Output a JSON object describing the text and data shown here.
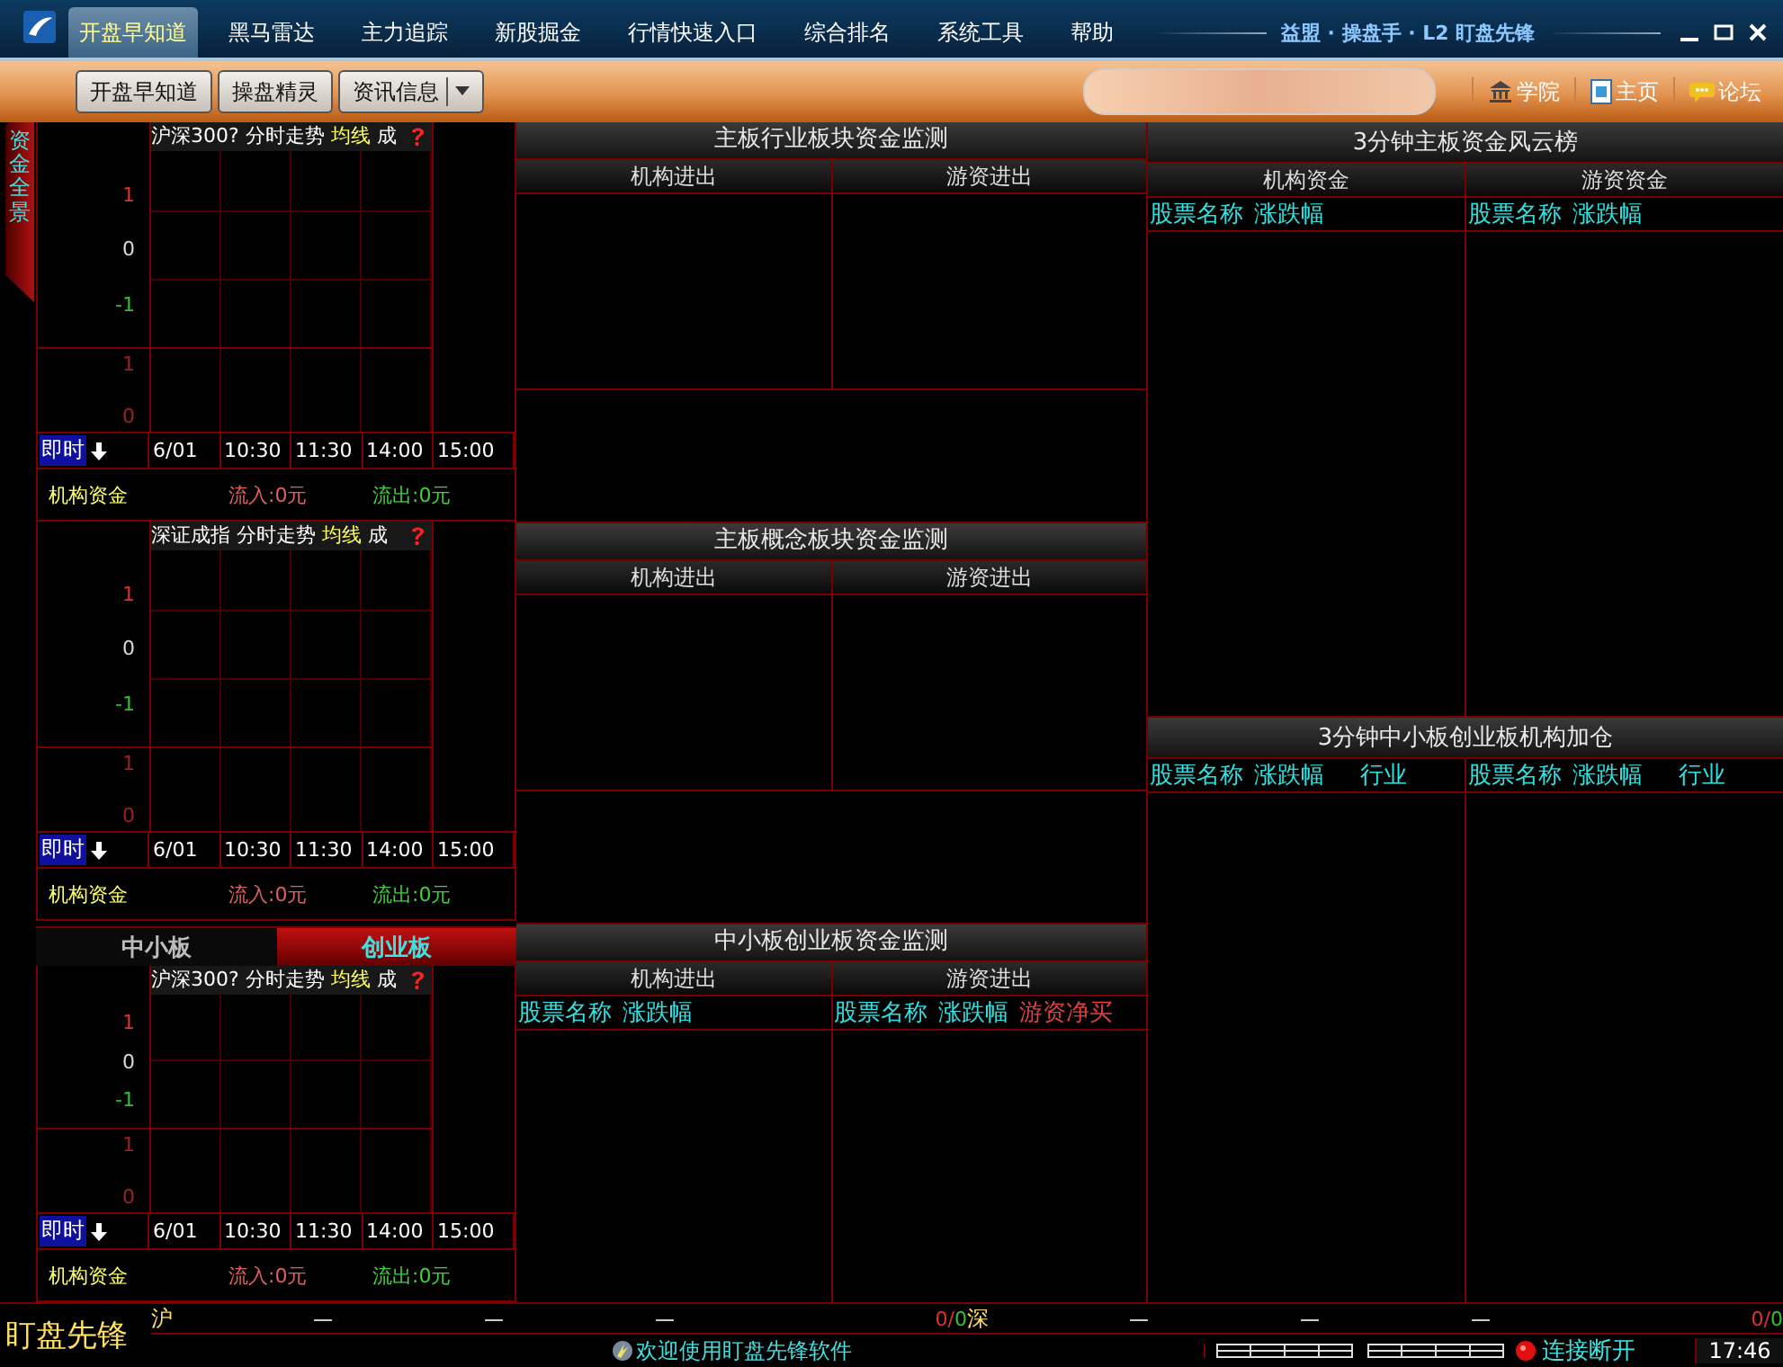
{
  "menu": [
    {
      "label": "开盘早知道",
      "selected": true
    },
    {
      "label": "黑马雷达",
      "selected": false
    },
    {
      "label": "主力追踪",
      "selected": false
    },
    {
      "label": "新股掘金",
      "selected": false
    },
    {
      "label": "行情快速入口",
      "selected": false
    },
    {
      "label": "综合排名",
      "selected": false
    },
    {
      "label": "系统工具",
      "selected": false
    },
    {
      "label": "帮助",
      "selected": false
    }
  ],
  "window_title": "益盟 · 操盘手 · L2 盯盘先锋",
  "toolbar": {
    "buttons": [
      {
        "label": "开盘早知道",
        "kind": "plain"
      },
      {
        "label": "操盘精灵",
        "kind": "plain"
      },
      {
        "label": "资讯信息",
        "kind": "dropdown"
      }
    ],
    "links": [
      {
        "label": "学院",
        "kind": "academy"
      },
      {
        "label": "主页",
        "kind": "home"
      },
      {
        "label": "论坛",
        "kind": "forum"
      }
    ]
  },
  "side_tab": "资金全景",
  "charts": [
    {
      "index": "沪深300?",
      "mode": "分时走势",
      "ma": "均线",
      "vol": "成",
      "price_ticks": [
        {
          "text": "1",
          "kind": "up"
        },
        {
          "text": "0",
          "kind": "flat"
        },
        {
          "text": "-1",
          "kind": "down"
        }
      ],
      "volume_ticks": [
        "1",
        "0"
      ],
      "time_button": "即时",
      "times": [
        "6/01",
        "10:30",
        "11:30",
        "14:00",
        "15:00"
      ],
      "fund": {
        "label": "机构资金",
        "inflow": "流入:0元",
        "outflow": "流出:0元"
      }
    },
    {
      "index": "深证成指",
      "mode": "分时走势",
      "ma": "均线",
      "vol": "成",
      "price_ticks": [
        {
          "text": "1",
          "kind": "up"
        },
        {
          "text": "0",
          "kind": "flat"
        },
        {
          "text": "-1",
          "kind": "down"
        }
      ],
      "volume_ticks": [
        "1",
        "0"
      ],
      "time_button": "即时",
      "times": [
        "6/01",
        "10:30",
        "11:30",
        "14:00",
        "15:00"
      ],
      "fund": {
        "label": "机构资金",
        "inflow": "流入:0元",
        "outflow": "流出:0元"
      }
    },
    {
      "tabs": [
        {
          "label": "中小板",
          "selected": false
        },
        {
          "label": "创业板",
          "selected": true
        }
      ],
      "index": "沪深300?",
      "mode": "分时走势",
      "ma": "均线",
      "vol": "成",
      "price_ticks": [
        {
          "text": "1",
          "kind": "up"
        },
        {
          "text": "0",
          "kind": "flat"
        },
        {
          "text": "-1",
          "kind": "down"
        }
      ],
      "volume_ticks": [
        "1",
        "0"
      ],
      "time_button": "即时",
      "times": [
        "6/01",
        "10:30",
        "11:30",
        "14:00",
        "15:00"
      ],
      "fund": {
        "label": "机构资金",
        "inflow": "流入:0元",
        "outflow": "流出:0元"
      }
    }
  ],
  "middle_sections": [
    {
      "title": "主板行业板块资金监测",
      "columns": [
        {
          "label": "机构进出"
        },
        {
          "label": "游资进出"
        }
      ]
    },
    {
      "title": "主板概念板块资金监测",
      "columns": [
        {
          "label": "机构进出"
        },
        {
          "label": "游资进出"
        }
      ]
    },
    {
      "title": "中小板创业板资金监测",
      "columns": [
        {
          "label": "机构进出",
          "fields": [
            {
              "text": "股票名称",
              "kind": "field"
            },
            {
              "text": "涨跌幅",
              "kind": "field"
            }
          ]
        },
        {
          "label": "游资进出",
          "fields": [
            {
              "text": "股票名称",
              "kind": "field"
            },
            {
              "text": "涨跌幅",
              "kind": "field"
            },
            {
              "text": "游资净买",
              "kind": "net"
            }
          ]
        }
      ]
    }
  ],
  "right_sections": [
    {
      "title": "3分钟主板资金风云榜",
      "columns": [
        {
          "label": "机构资金",
          "fields": [
            {
              "text": "股票名称",
              "kind": "field"
            },
            {
              "text": "涨跌幅",
              "kind": "field"
            }
          ]
        },
        {
          "label": "游资资金",
          "fields": [
            {
              "text": "股票名称",
              "kind": "field"
            },
            {
              "text": "涨跌幅",
              "kind": "field"
            }
          ]
        }
      ]
    },
    {
      "title": "3分钟中小板创业板机构加仓",
      "columns": [
        {
          "fields": [
            {
              "text": "股票名称",
              "kind": "field"
            },
            {
              "text": "涨跌幅",
              "kind": "field"
            },
            {
              "text": "行业",
              "kind": "field"
            }
          ]
        },
        {
          "fields": [
            {
              "text": "股票名称",
              "kind": "field"
            },
            {
              "text": "涨跌幅",
              "kind": "field"
            },
            {
              "text": "行业",
              "kind": "field"
            }
          ]
        }
      ]
    }
  ],
  "status": {
    "brand": "盯盘先锋",
    "markets": [
      {
        "name": "沪",
        "values": [
          "—",
          "—",
          "—"
        ],
        "up": "0/",
        "down": "0"
      },
      {
        "name": "深",
        "values": [
          "—",
          "—",
          "—"
        ],
        "up": "0/",
        "down": "0"
      }
    ],
    "welcome": "欢迎使用盯盘先锋软件",
    "connection": "连接断开",
    "time": "17:46"
  }
}
